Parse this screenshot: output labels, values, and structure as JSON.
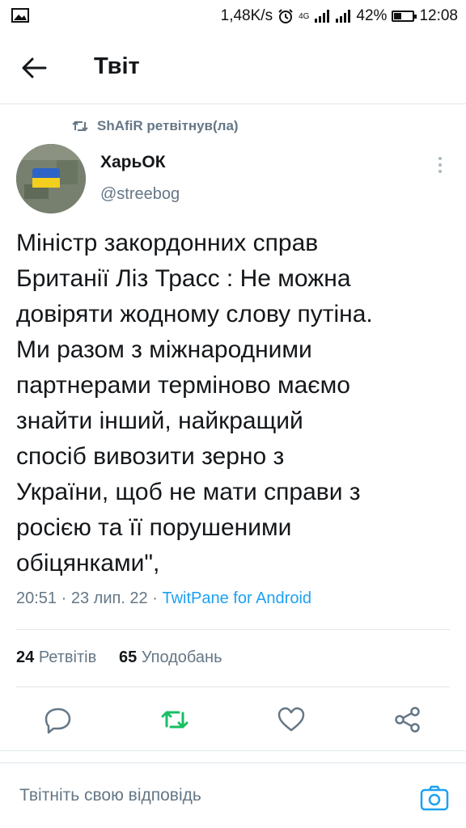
{
  "status_bar": {
    "speed": "1,48K/s",
    "network": "4G",
    "battery": "42%",
    "battery_level": 0.42,
    "time": "12:08"
  },
  "header": {
    "title": "Твіт"
  },
  "retweet": {
    "label": "ShAfiR ретвітнув(ла)"
  },
  "tweet": {
    "author_name": "ХарьОК",
    "author_handle": "@streebog",
    "lines": [
      "Міністр закордонних справ",
      "Британії Ліз Трасс : Не можна",
      "довіряти жодному слову путіна.",
      "Ми разом з міжнародними",
      "партнерами терміново маємо",
      "знайти інший, найкращий",
      "спосіб вивозити зерно з",
      "України, щоб не мати справи з",
      "росією та її порушеними",
      "обіцянками\","
    ],
    "time": "20:51",
    "date": "23 лип. 22",
    "app": "TwitPane for Android"
  },
  "stats": {
    "retweets_count": "24",
    "retweets_label": "Ретвітів",
    "likes_count": "65",
    "likes_label": "Уподобань"
  },
  "reply": {
    "placeholder": "Твітніть свою відповідь"
  },
  "colors": {
    "accent": "#1da1f2",
    "retweet_green": "#17bf63",
    "secondary_text": "#657786",
    "divider": "#e1e8ed"
  }
}
